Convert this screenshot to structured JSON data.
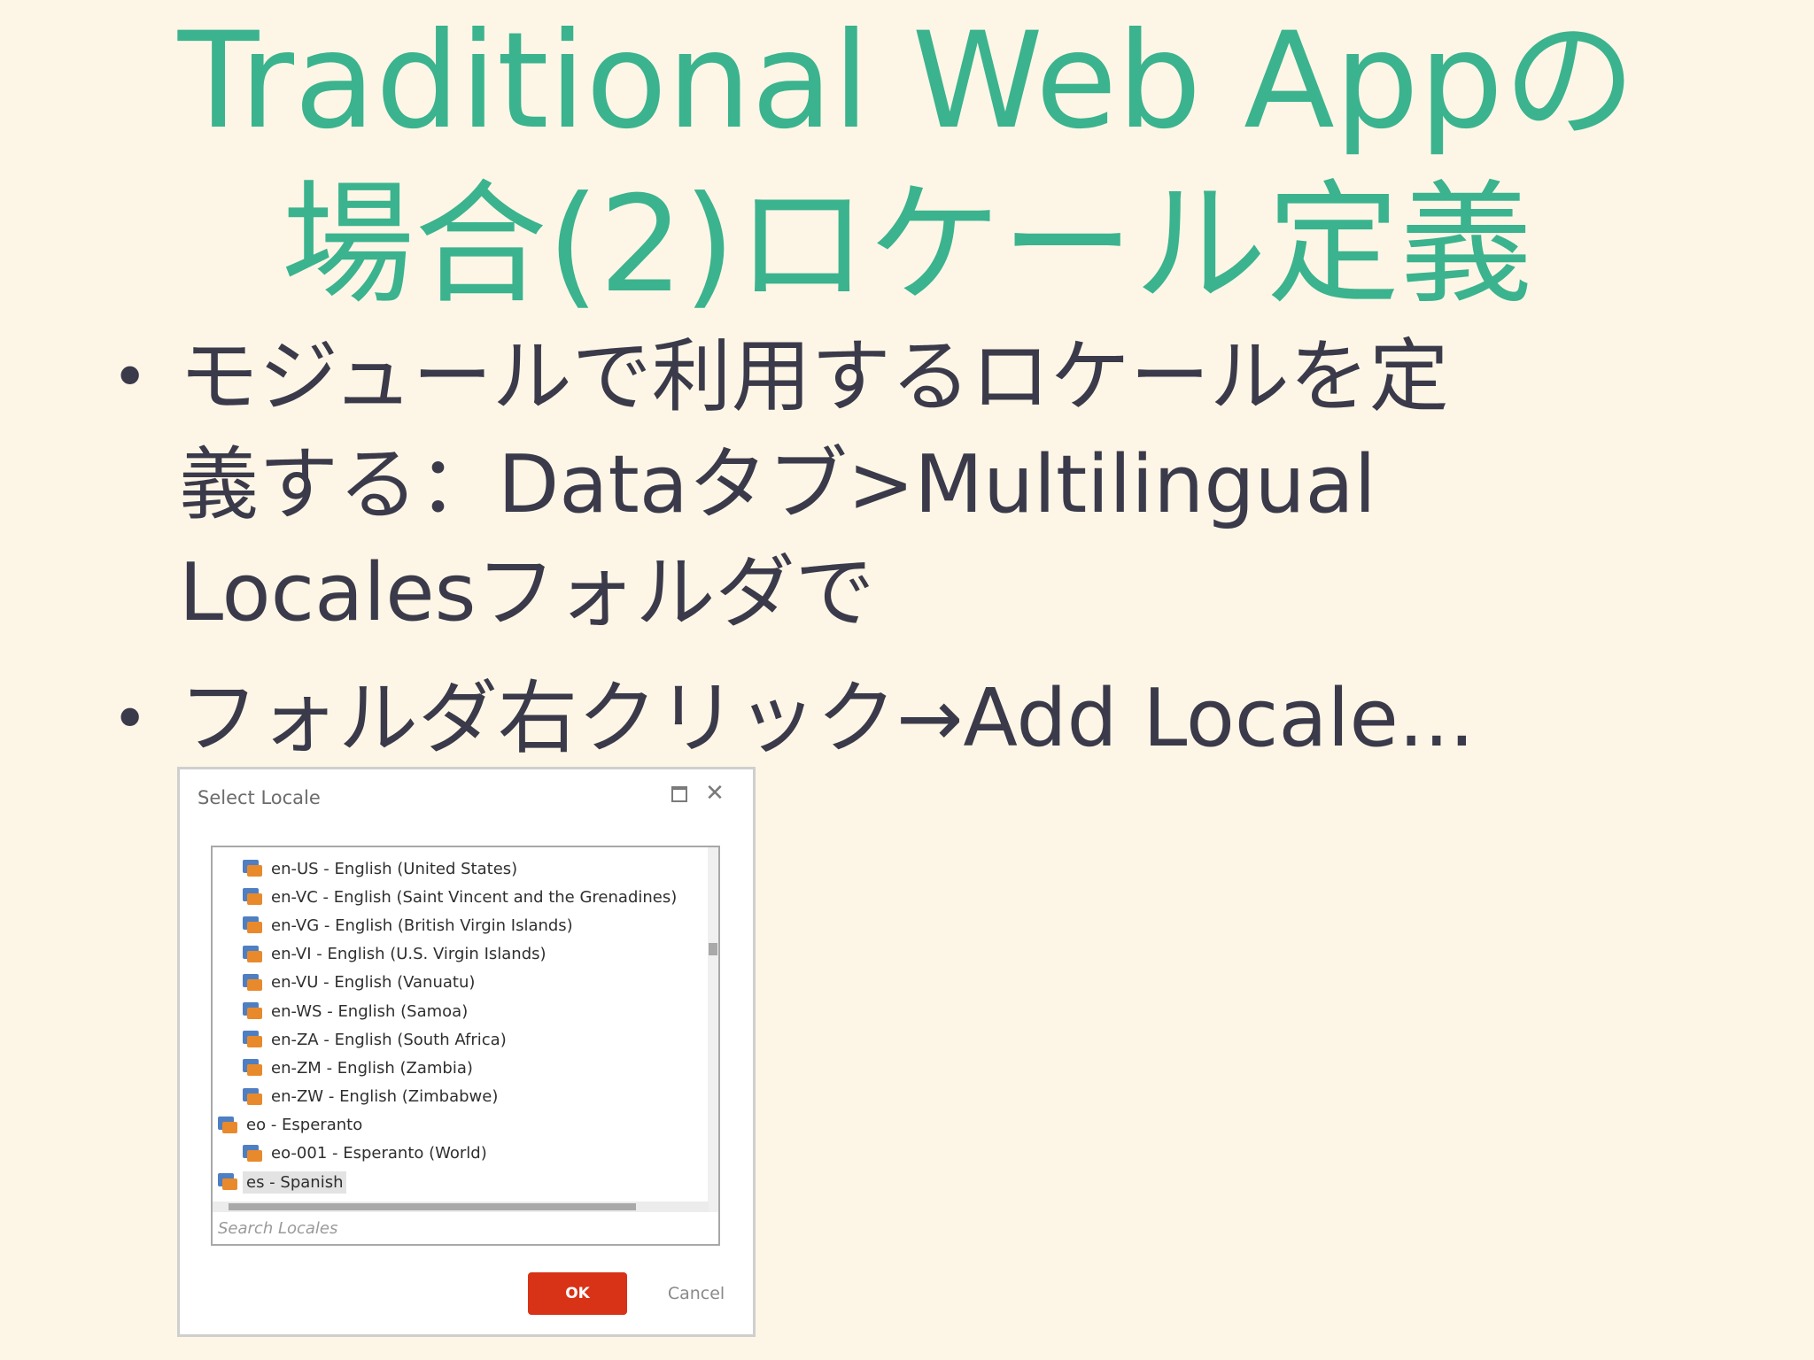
{
  "slide": {
    "title_lines": [
      "Traditional Web Appの",
      "場合(2)ロケール定義"
    ],
    "bullets": [
      {
        "lines": [
          "モジュールで利用するロケールを定",
          "義する：Dataタブ>Multilingual",
          "Localesフォルダで"
        ]
      },
      {
        "lines": [
          "フォルダ右クリック→Add Locale..."
        ]
      }
    ],
    "bullet_symbol": "•"
  },
  "dialog": {
    "title": "Select Locale",
    "close_symbol": "✕",
    "locales": [
      {
        "code": "en-US",
        "name": "English (United States)",
        "level": 2
      },
      {
        "code": "en-VC",
        "name": "English (Saint Vincent and the Grenadines)",
        "level": 2
      },
      {
        "code": "en-VG",
        "name": "English (British Virgin Islands)",
        "level": 2
      },
      {
        "code": "en-VI",
        "name": "English (U.S. Virgin Islands)",
        "level": 2
      },
      {
        "code": "en-VU",
        "name": "English (Vanuatu)",
        "level": 2
      },
      {
        "code": "en-WS",
        "name": "English (Samoa)",
        "level": 2
      },
      {
        "code": "en-ZA",
        "name": "English (South Africa)",
        "level": 2
      },
      {
        "code": "en-ZM",
        "name": "English (Zambia)",
        "level": 2
      },
      {
        "code": "en-ZW",
        "name": "English (Zimbabwe)",
        "level": 2
      },
      {
        "code": "eo",
        "name": "Esperanto",
        "level": 1
      },
      {
        "code": "eo-001",
        "name": "Esperanto (World)",
        "level": 2
      },
      {
        "code": "es",
        "name": "Spanish",
        "level": 1,
        "selected": true
      }
    ],
    "search": {
      "value": "",
      "placeholder": "Search Locales"
    },
    "ok_label": "OK",
    "cancel_label": "Cancel",
    "icon_name": "locale-flag-icon",
    "colors": {
      "ok": "#d83217",
      "title_text": "#3bb38e"
    }
  }
}
